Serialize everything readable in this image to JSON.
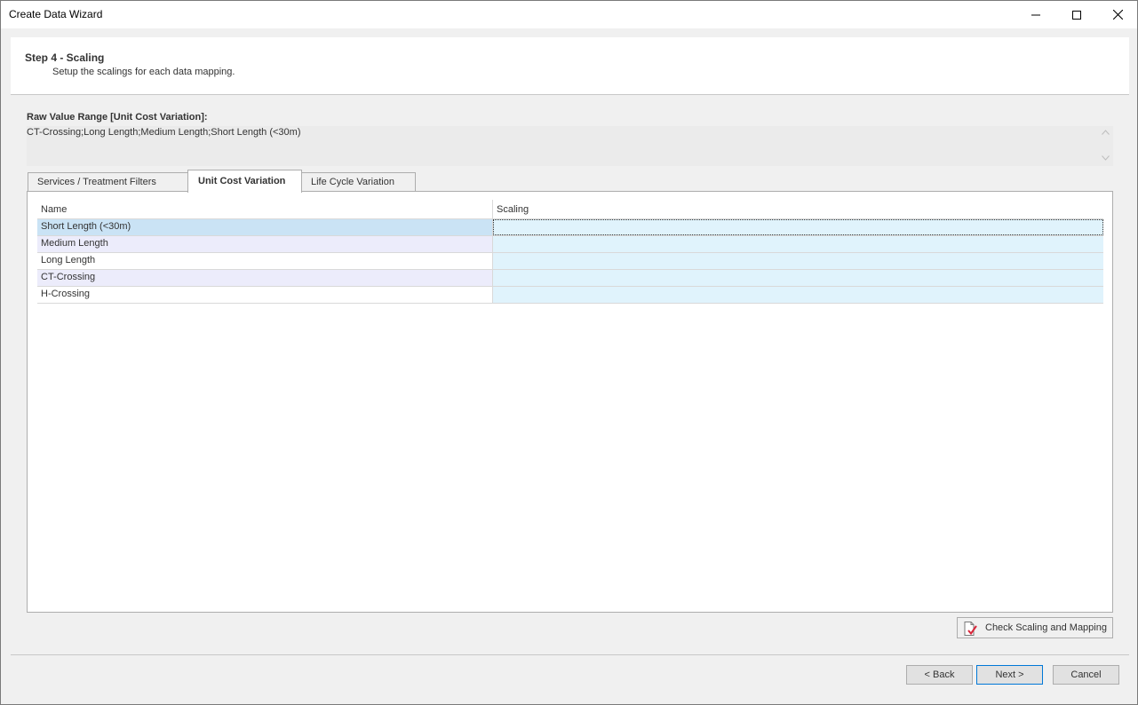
{
  "window": {
    "title": "Create Data Wizard",
    "minimize_icon": "minimize-icon",
    "maximize_icon": "maximize-icon",
    "close_icon": "close-icon"
  },
  "header": {
    "step_title": "Step 4 - Scaling",
    "step_description": "Setup the scalings for each data mapping."
  },
  "raw_range": {
    "label": "Raw Value Range [Unit Cost Variation]:",
    "value": "CT-Crossing;Long Length;Medium Length;Short Length (<30m)"
  },
  "tabs": [
    {
      "label": "Services / Treatment Filters",
      "active": false
    },
    {
      "label": "Unit Cost Variation",
      "active": true
    },
    {
      "label": "Life Cycle Variation",
      "active": false
    }
  ],
  "grid": {
    "columns": [
      "Name",
      "Scaling"
    ],
    "rows": [
      {
        "name": "Short Length (<30m)",
        "scaling": ""
      },
      {
        "name": "Medium Length",
        "scaling": ""
      },
      {
        "name": "Long Length",
        "scaling": ""
      },
      {
        "name": "CT-Crossing",
        "scaling": ""
      },
      {
        "name": "H-Crossing",
        "scaling": ""
      }
    ]
  },
  "buttons": {
    "check": "Check Scaling and Mapping",
    "back": "< Back",
    "next": "Next >",
    "cancel": "Cancel"
  },
  "colors": {
    "selected_row": "#cae3f5",
    "alt_row": "#ececfb",
    "scaling_cell": "#e0f3fc",
    "default_button_border": "#0078d7"
  }
}
